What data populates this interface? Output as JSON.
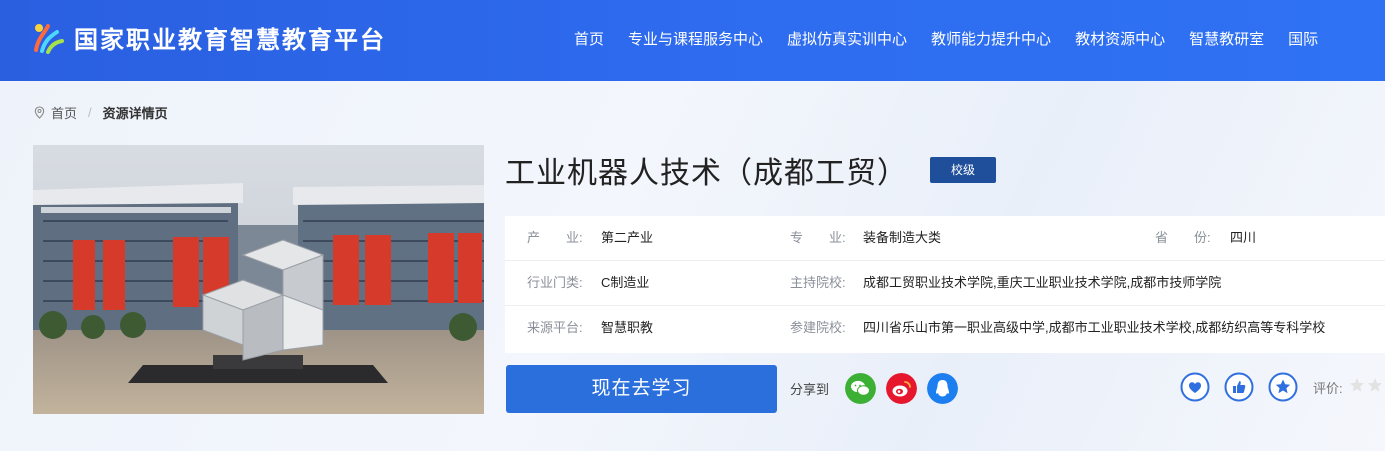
{
  "header": {
    "site_title": "国家职业教育智慧教育平台",
    "nav": [
      "首页",
      "专业与课程服务中心",
      "虚拟仿真实训中心",
      "教师能力提升中心",
      "教材资源中心",
      "智慧教研室",
      "国际"
    ]
  },
  "breadcrumb": {
    "home": "首页",
    "separator": "/",
    "current": "资源详情页"
  },
  "course": {
    "title": "工业机器人技术（成都工贸）",
    "level": "校级"
  },
  "info": {
    "industry_label": "产　　业:",
    "industry_value": "第二产业",
    "major_label": "专　　业:",
    "major_value": "装备制造大类",
    "province_label": "省　　份:",
    "province_value": "四川",
    "category_label": "行业门类:",
    "category_value": "C制造业",
    "host_label": "主持院校:",
    "host_value": "成都工贸职业技术学院,重庆工业职业技术学院,成都市技师学院",
    "source_label": "来源平台:",
    "source_value": "智慧职教",
    "partner_label": "参建院校:",
    "partner_value": "四川省乐山市第一职业高级中学,成都市工业职业技术学校,成都纺织高等专科学校"
  },
  "actions": {
    "study_button": "现在去学习",
    "share_label": "分享到",
    "rating_label": "评价:"
  },
  "colors": {
    "header_blue": "#2e6cf0",
    "badge_blue": "#1f4f9a",
    "button_blue": "#2a6fdc",
    "wechat_green": "#3cb034",
    "weibo_red": "#e6162d",
    "qq_blue": "#1d7ef0"
  }
}
